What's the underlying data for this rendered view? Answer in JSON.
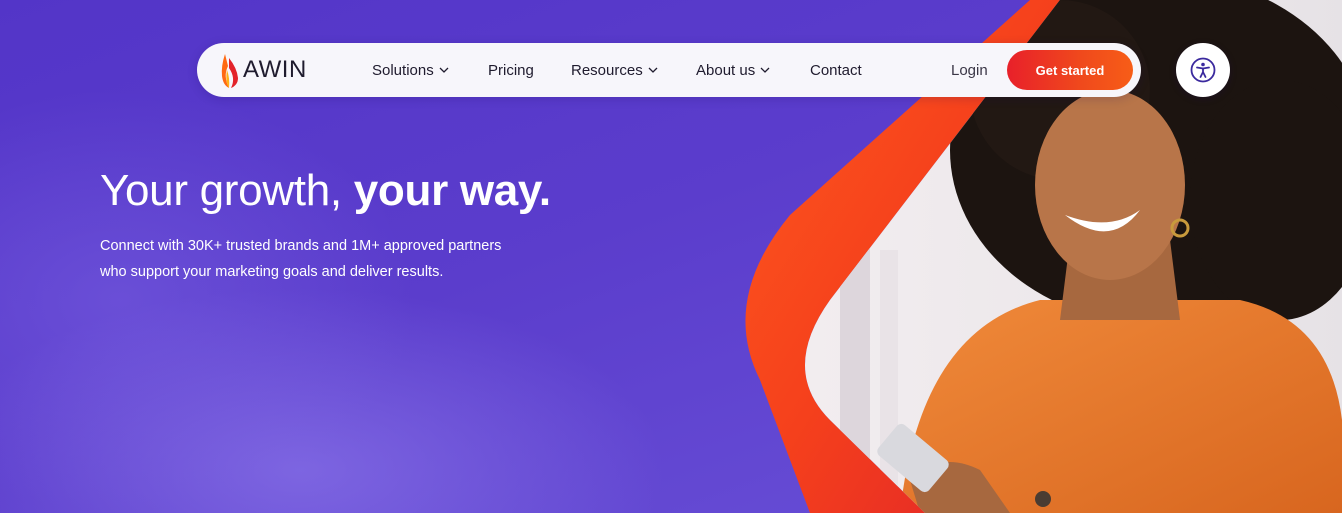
{
  "header": {
    "logo_text": "AWIN",
    "nav": {
      "solutions": "Solutions",
      "pricing": "Pricing",
      "resources": "Resources",
      "about": "About us",
      "contact": "Contact"
    },
    "login_label": "Login",
    "cta_label": "Get started"
  },
  "accessibility": {
    "icon": "accessibility-icon"
  },
  "hero": {
    "title_regular": "Your growth, ",
    "title_bold": "your way.",
    "subtitle_line1": "Connect with 30K+ trusted brands and 1M+ approved partners",
    "subtitle_line2": "who support your marketing goals and deliver results."
  },
  "colors": {
    "brand_purple": "#5a3ccc",
    "accent_orange": "#f04a1c",
    "cta_red": "#e8202a"
  }
}
